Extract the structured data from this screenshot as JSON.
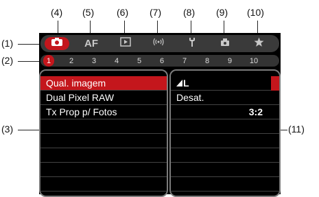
{
  "callouts": {
    "c1": "(1)",
    "c2": "(2)",
    "c3": "(3)",
    "c4": "(4)",
    "c5": "(5)",
    "c6": "(6)",
    "c7": "(7)",
    "c8": "(8)",
    "c9": "(9)",
    "c10": "(10)",
    "c11": "(11)"
  },
  "tabs": [
    {
      "icon": "camera-icon"
    },
    {
      "label": "AF",
      "icon": "af-icon"
    },
    {
      "icon": "playback-icon"
    },
    {
      "icon": "wireless-icon"
    },
    {
      "icon": "wrench-icon"
    },
    {
      "icon": "custom-functions-icon"
    },
    {
      "icon": "star-icon"
    }
  ],
  "pages": [
    "1",
    "2",
    "3",
    "4",
    "5",
    "6",
    "7",
    "8",
    "9",
    "10"
  ],
  "menu": {
    "items": [
      "Qual. imagem",
      "Dual Pixel RAW",
      "Tx Prop p/ Fotos"
    ],
    "values": [
      "L",
      "Desat.",
      "3:2"
    ]
  },
  "colors": {
    "accent": "#c4161c"
  }
}
